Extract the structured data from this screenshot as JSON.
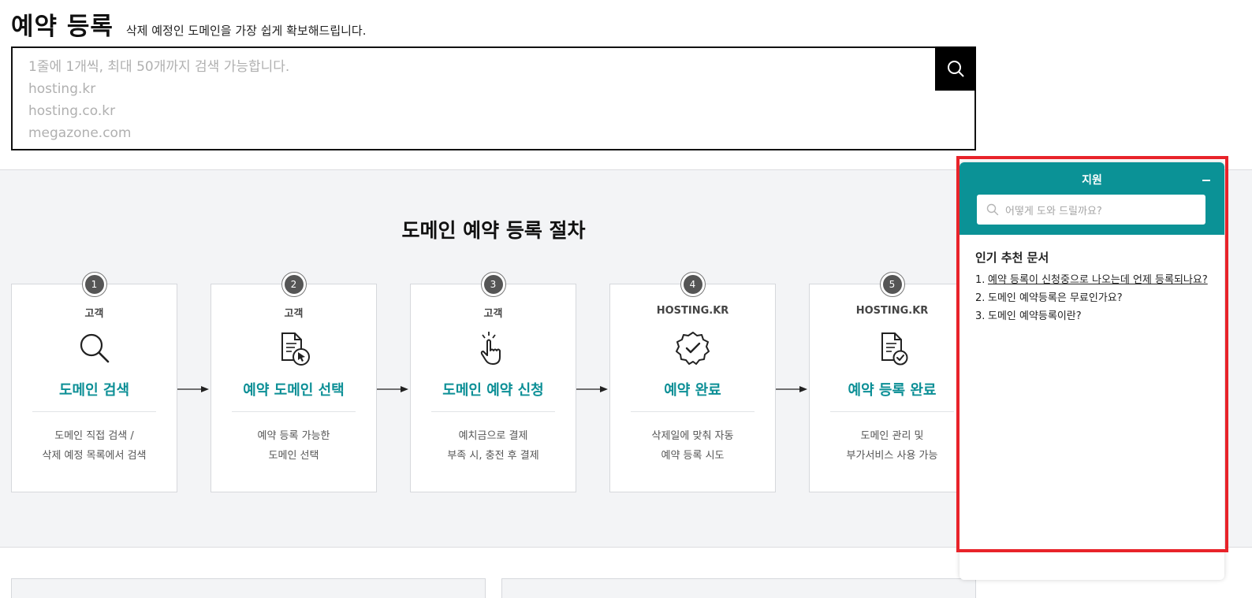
{
  "header": {
    "title": "예약 등록",
    "subtitle": "삭제 예정인 도메인을 가장 쉽게 확보해드립니다."
  },
  "search": {
    "placeholder_lines": [
      "1줄에 1개씩, 최대 50개까지 검색 가능합니다.",
      "hosting.kr",
      "hosting.co.kr",
      "megazone.com"
    ],
    "button_icon": "search-icon"
  },
  "procedure": {
    "title": "도메인 예약 등록 절차",
    "steps": [
      {
        "num": "1",
        "actor": "고객",
        "icon": "search-icon",
        "name": "도메인 검색",
        "desc": [
          "도메인 직접 검색 /",
          "삭제 예정 목록에서 검색"
        ]
      },
      {
        "num": "2",
        "actor": "고객",
        "icon": "document-cursor-icon",
        "name": "예약 도메인 선택",
        "desc": [
          "예약 등록 가능한",
          "도메인 선택"
        ]
      },
      {
        "num": "3",
        "actor": "고객",
        "icon": "hand-tap-icon",
        "name": "도메인 예약 신청",
        "desc": [
          "예치금으로 결제",
          "부족 시, 충전 후 결제"
        ]
      },
      {
        "num": "4",
        "actor": "HOSTING.KR",
        "icon": "badge-check-icon",
        "name": "예약 완료",
        "desc": [
          "삭제일에 맞춰 자동",
          "예약 등록 시도"
        ]
      },
      {
        "num": "5",
        "actor": "HOSTING.KR",
        "icon": "document-check-icon",
        "name": "예약 등록 완료",
        "desc": [
          "도메인 관리 및",
          "부가서비스 사용 가능"
        ]
      }
    ]
  },
  "support": {
    "title": "지원",
    "search_placeholder": "어떻게 도와 드릴까요?",
    "popular_title": "인기 추천 문서",
    "popular_items": [
      {
        "num": "1.",
        "text": "예약 등록이 신청중으로 나오는데 언제 등록되나요?"
      },
      {
        "num": "2.",
        "text": "도메인 예약등록은 무료인가요?"
      },
      {
        "num": "3.",
        "text": "도메인 예약등록이란?"
      }
    ],
    "colors": {
      "header": "#0b9296",
      "outline": "#e8232a"
    }
  },
  "colors": {
    "accent": "#0c8f96",
    "section_bg": "#f3f4f6"
  }
}
